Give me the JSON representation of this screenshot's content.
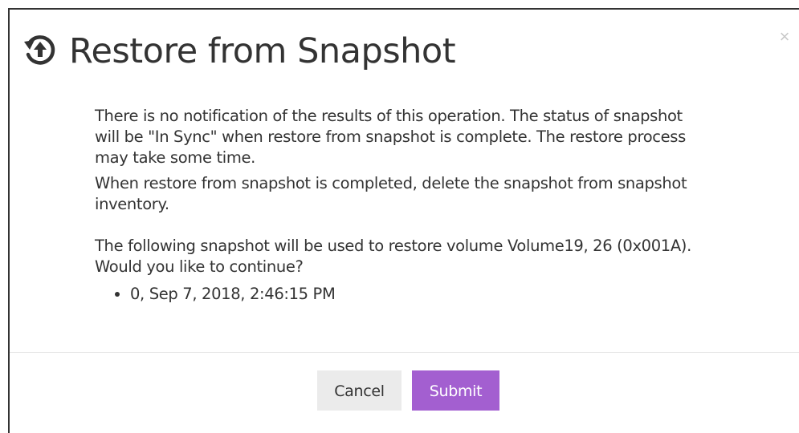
{
  "dialog": {
    "title": "Restore from Snapshot",
    "close_label": "×",
    "paragraphs": [
      "There is no notification of the results of this operation. The status of snapshot will be \"In Sync\" when restore from snapshot is complete. The restore process may take some time.",
      "When restore from snapshot is completed, delete the snapshot from snapshot inventory.",
      "The following snapshot will be used to restore volume Volume19, 26 (0x001A). Would you like to continue?"
    ],
    "snapshots": [
      "0, Sep 7, 2018, 2:46:15 PM"
    ],
    "buttons": {
      "cancel_label": "Cancel",
      "submit_label": "Submit"
    }
  },
  "colors": {
    "submit_background": "#a35fd0",
    "cancel_background": "#ebebeb",
    "icon": "#333333"
  },
  "icons": {
    "title_icon": "restore-history-icon",
    "close_icon": "close-icon"
  }
}
